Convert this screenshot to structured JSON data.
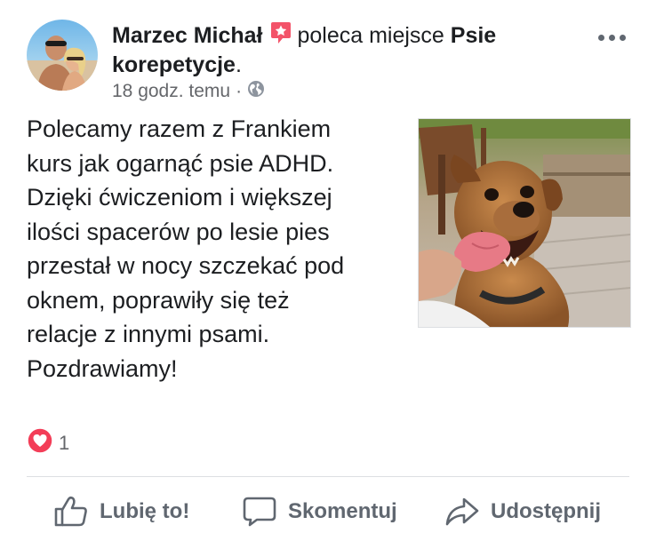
{
  "post": {
    "author": "Marzec Michał",
    "action_text": "poleca miejsce",
    "page_name": "Psie",
    "page_name_line2": "korepetycje",
    "period": ".",
    "timestamp": "18 godz. temu",
    "separator": "·",
    "audience_icon": "globe-icon",
    "recommend_icon": "recommendation-star-icon",
    "body_lines": [
      "Polecamy razem z Frankiem",
      "kurs jak ogarnąć psie ADHD.",
      "Dzięki ćwiczeniom i większej",
      "ilości spacerów po lesie pies",
      "przestał w nocy szczekać pod",
      "oknem, poprawiły się też",
      "relacje z innymi psami.",
      "Pozdrawiamy!"
    ],
    "photo_subject": "dog-photo",
    "reaction_icon": "love-reaction-icon",
    "reaction_count": "1"
  },
  "actions": {
    "like_label": "Lubię to!",
    "comment_label": "Skomentuj",
    "share_label": "Udostępnij"
  },
  "colors": {
    "text_primary": "#1c1e21",
    "text_secondary": "#65676b",
    "recommend_red": "#f35369",
    "love_red": "#f33e58",
    "divider": "#dddfe2"
  }
}
